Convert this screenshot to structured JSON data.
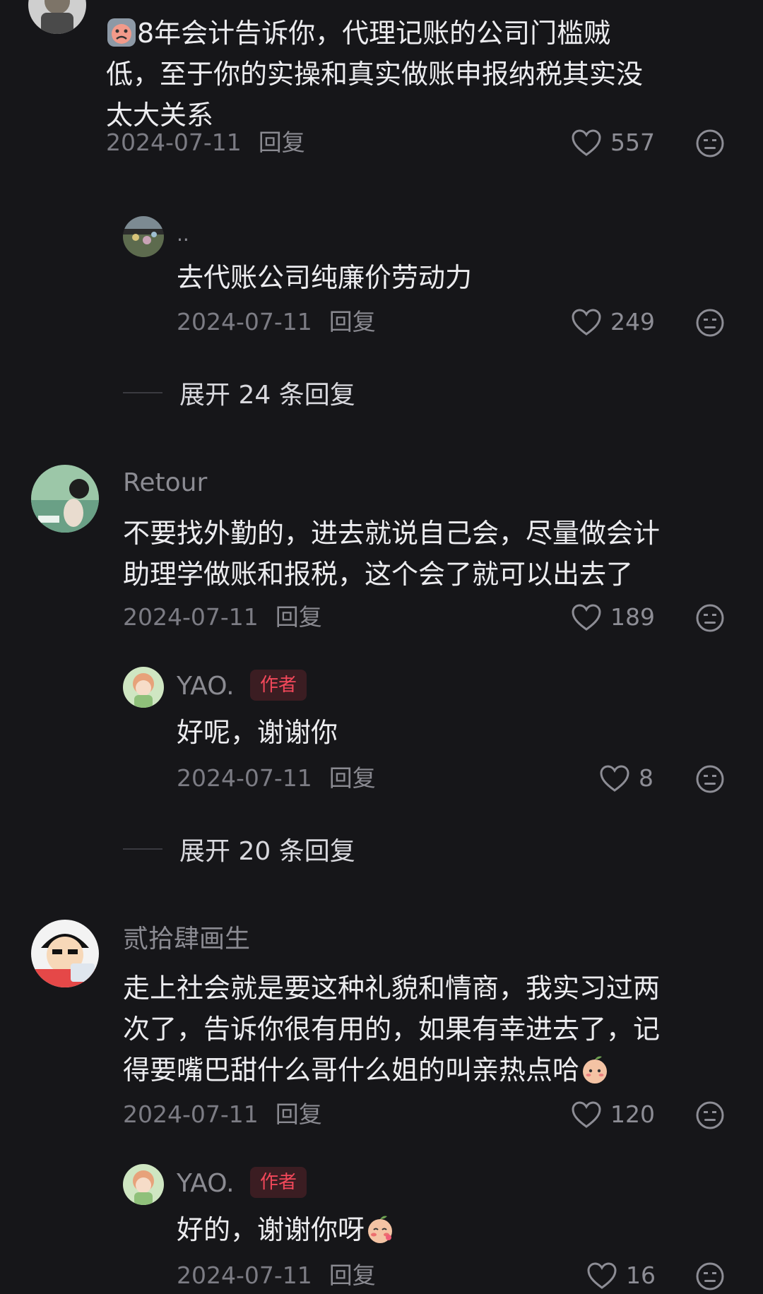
{
  "comments": [
    {
      "name": "",
      "text_lines": [
        "8年会计告诉你，代理记账的公司门槛贼",
        "低，至于你的实操和真实做账申报纳税其实没",
        "太大关系"
      ],
      "date": "2024-07-11",
      "reply_label": "回复",
      "likes": "557",
      "replies": [
        {
          "name": "..",
          "text_lines": [
            "去代账公司纯廉价劳动力"
          ],
          "date": "2024-07-11",
          "reply_label": "回复",
          "likes": "249"
        }
      ],
      "expand_label": "展开 24 条回复"
    },
    {
      "name": "Retour",
      "text_lines": [
        "不要找外勤的，进去就说自己会，尽量做会计",
        "助理学做账和报税，这个会了就可以出去了"
      ],
      "date": "2024-07-11",
      "reply_label": "回复",
      "likes": "189",
      "replies": [
        {
          "name": "YAO.",
          "badge": "作者",
          "text_lines": [
            "好呢，谢谢你"
          ],
          "date": "2024-07-11",
          "reply_label": "回复",
          "likes": "8"
        }
      ],
      "expand_label": "展开 20 条回复"
    },
    {
      "name": "贰拾肆画生",
      "text_lines": [
        "走上社会就是要这种礼貌和情商，我实习过两",
        "次了，告诉你很有用的，如果有幸进去了，记",
        "得要嘴巴甜什么哥什么姐的叫亲热点哈"
      ],
      "date": "2024-07-11",
      "reply_label": "回复",
      "likes": "120",
      "replies": [
        {
          "name": "YAO.",
          "badge": "作者",
          "text_lines": [
            "好的，谢谢你呀"
          ],
          "date": "2024-07-11",
          "reply_label": "回复",
          "likes": "16"
        }
      ]
    }
  ],
  "icons": {
    "like": "heart-outline-icon",
    "dislike": "neutral-face-icon"
  },
  "colors": {
    "background": "#161619",
    "badge_text": "#f2485a",
    "badge_bg": "#3b1d22"
  }
}
